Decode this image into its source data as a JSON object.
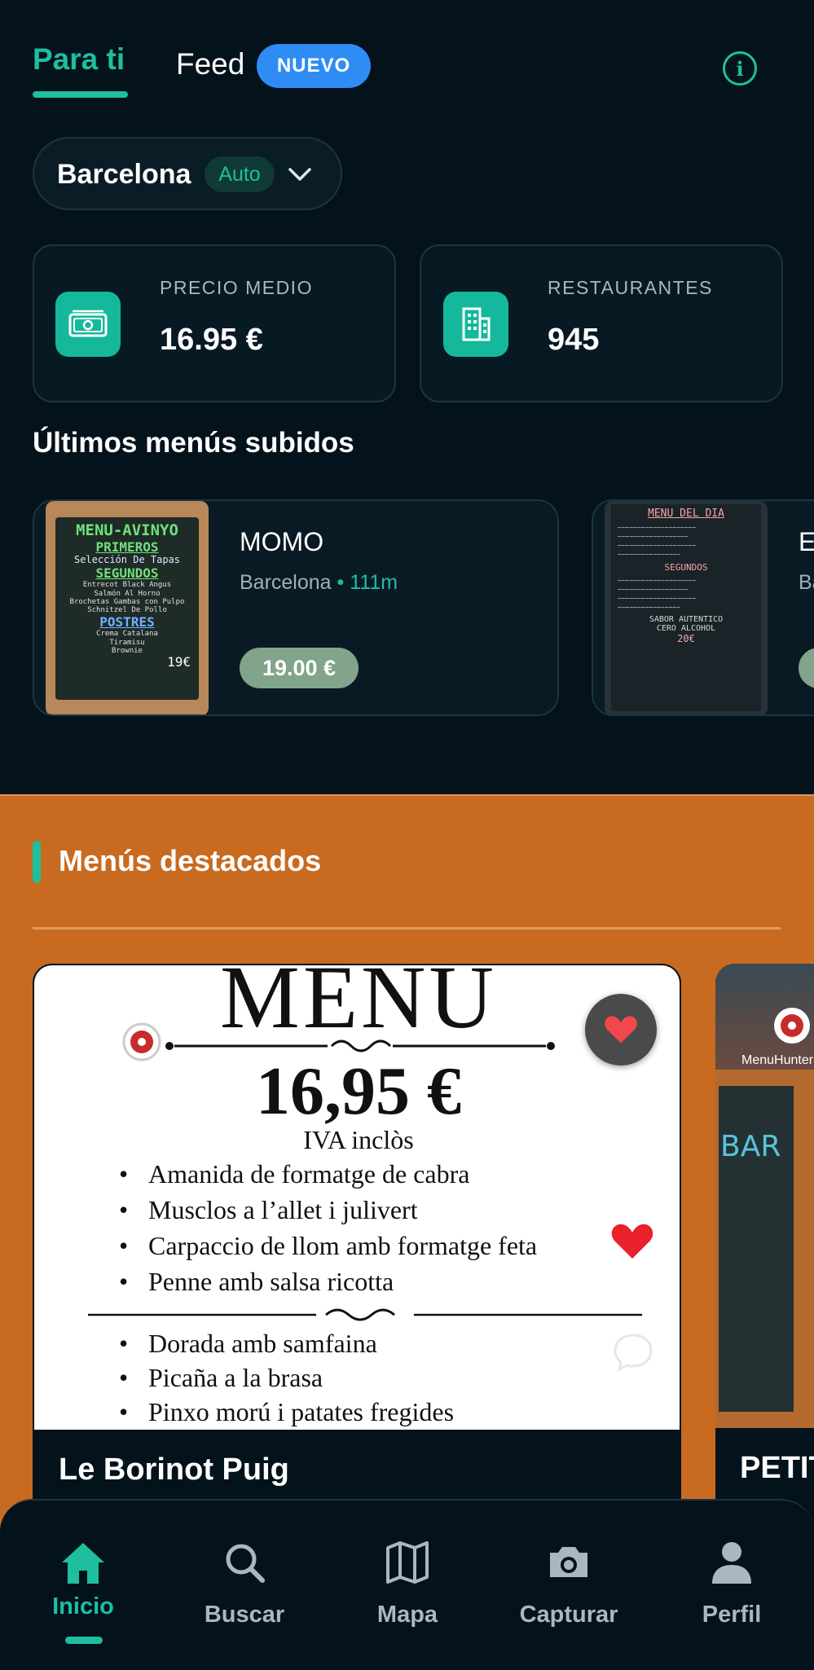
{
  "tabs": {
    "para_ti": "Para ti",
    "feed": "Feed",
    "badge": "NUEVO"
  },
  "info_icon": "info-icon",
  "city": {
    "name": "Barcelona",
    "auto": "Auto"
  },
  "stats": {
    "precio_label": "PRECIO MEDIO",
    "precio_value": "16.95 €",
    "rest_label": "RESTAURANTES",
    "rest_value": "945"
  },
  "recent": {
    "title": "Últimos menús subidos",
    "items": [
      {
        "name": "MOMO",
        "city": "Barcelona",
        "dist": "111m",
        "price": "19.00 €",
        "chalk": [
          "MENU-AVINYO",
          "PRIMEROS",
          "Selección De Tapas",
          "SEGUNDOS",
          "Entrecot Black Angus",
          "Salmón Al Horno",
          "Brochetas Gambas con Pulpo",
          "Schnitzel De Pollo",
          "POSTRES",
          "Crema Catalana",
          "Tiramisu",
          "Brownie",
          "19€"
        ]
      },
      {
        "name": "E",
        "city": "Ba",
        "chalk": [
          "MENU DEL DIA",
          "SEGUNDOS",
          "SABOR AUTENTICO",
          "CERO ALCOHOL",
          "20€"
        ]
      }
    ]
  },
  "featured": {
    "title": "Menús destacados",
    "card1": {
      "name": "Le Borinot Puig",
      "menu_title": "MENU",
      "menu_price": "16,95 €",
      "iva": "IVA inclòs",
      "starters": [
        "Amanida de formatge de cabra",
        "Musclos a l’allet i julivert",
        "Carpaccio de llom amb formatge feta",
        "Penne amb salsa ricotta"
      ],
      "mains": [
        "Dorada amb samfaina",
        "Picaña a la brasa",
        "Pinxo morú i patates fregides"
      ]
    },
    "card2": {
      "name": "PETIT",
      "sign": "BAR",
      "watermark": "MenuHunter"
    }
  },
  "nav": [
    {
      "label": "Inicio",
      "icon": "home-icon"
    },
    {
      "label": "Buscar",
      "icon": "search-icon"
    },
    {
      "label": "Mapa",
      "icon": "map-icon"
    },
    {
      "label": "Capturar",
      "icon": "camera-icon"
    },
    {
      "label": "Perfil",
      "icon": "profile-icon"
    }
  ],
  "colors": {
    "accent": "#1dbf9f",
    "background": "#04121b",
    "orange": "#c86a1f",
    "badge_blue": "#2f8cf5",
    "price_pill": "#82a48a"
  }
}
